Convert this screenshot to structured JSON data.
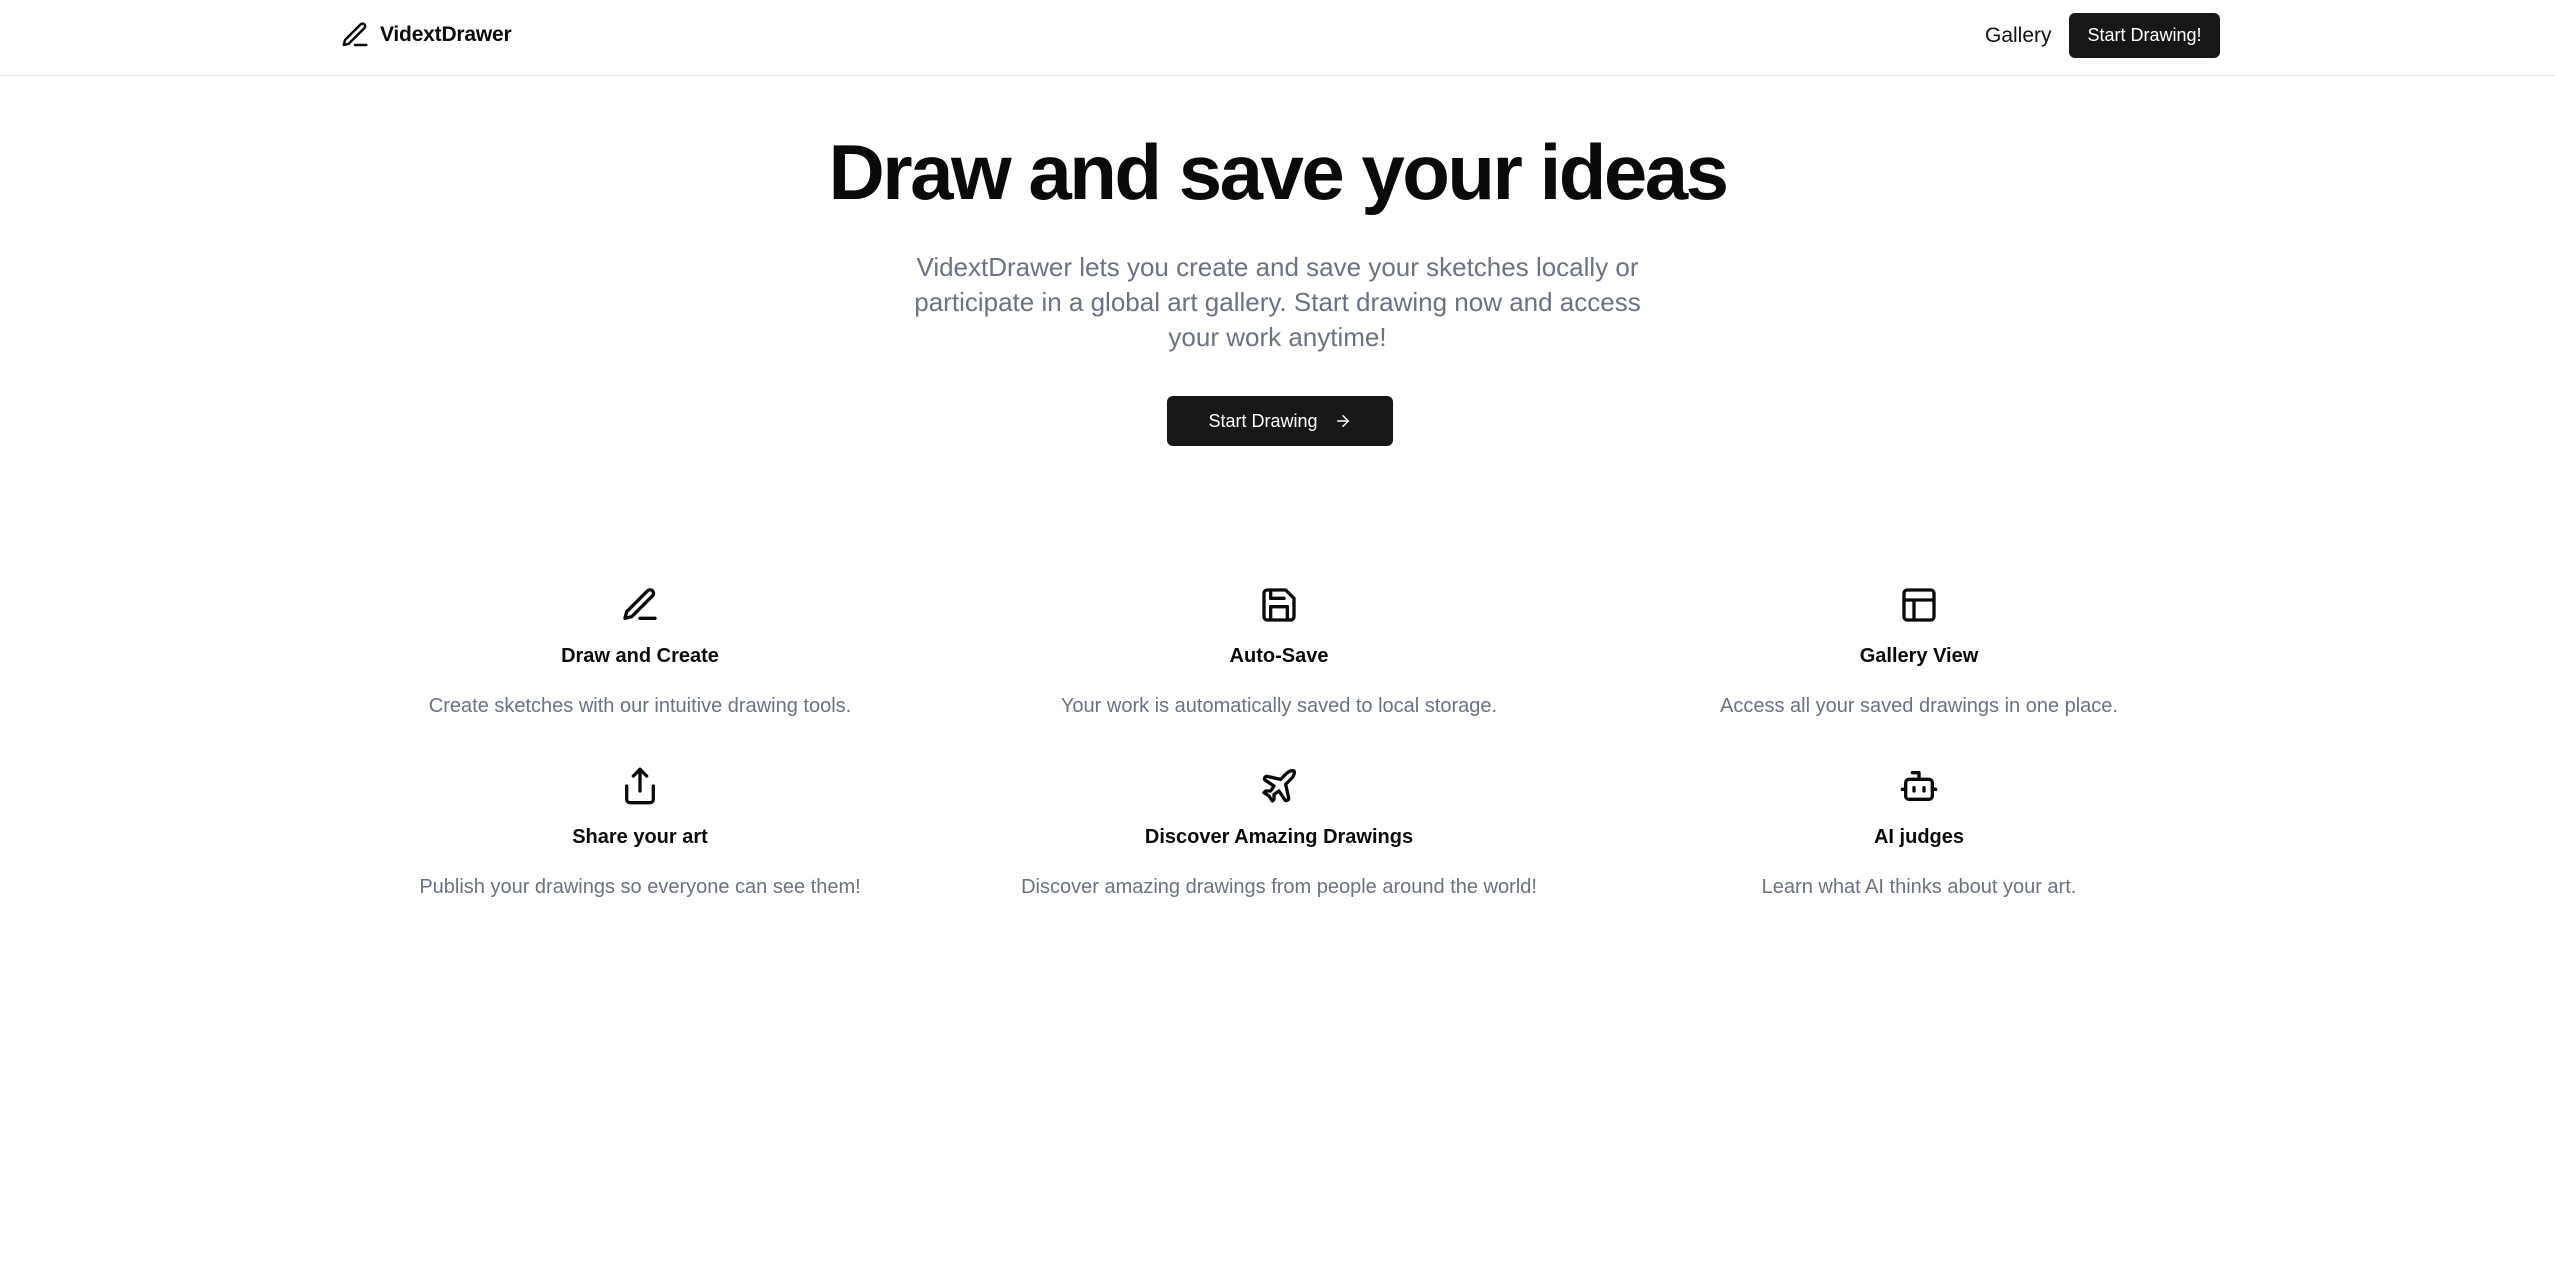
{
  "header": {
    "brand_name": "VidextDrawer",
    "brand_icon": "pencil-icon",
    "nav_gallery": "Gallery",
    "nav_start": "Start Drawing!"
  },
  "hero": {
    "title": "Draw and save your ideas",
    "subtitle": "VidextDrawer lets you create and save your sketches locally or participate in a global art gallery. Start drawing now and access your work anytime!",
    "button_label": "Start Drawing",
    "button_icon": "arrow-right-icon"
  },
  "features": [
    {
      "icon": "pencil-icon",
      "title": "Draw and Create",
      "description": "Create sketches with our intuitive drawing tools."
    },
    {
      "icon": "save-icon",
      "title": "Auto-Save",
      "description": "Your work is automatically saved to local storage."
    },
    {
      "icon": "layout-icon",
      "title": "Gallery View",
      "description": "Access all your saved drawings in one place."
    },
    {
      "icon": "share-icon",
      "title": "Share your art",
      "description": "Publish your drawings so everyone can see them!"
    },
    {
      "icon": "plane-icon",
      "title": "Discover Amazing Drawings",
      "description": "Discover amazing drawings from people around the world!"
    },
    {
      "icon": "bot-icon",
      "title": "AI judges",
      "description": "Learn what AI thinks about your art."
    }
  ],
  "colors": {
    "primary": "#171717",
    "text": "#0a0a0a",
    "muted": "#6b7280",
    "border": "#e5e7eb"
  }
}
